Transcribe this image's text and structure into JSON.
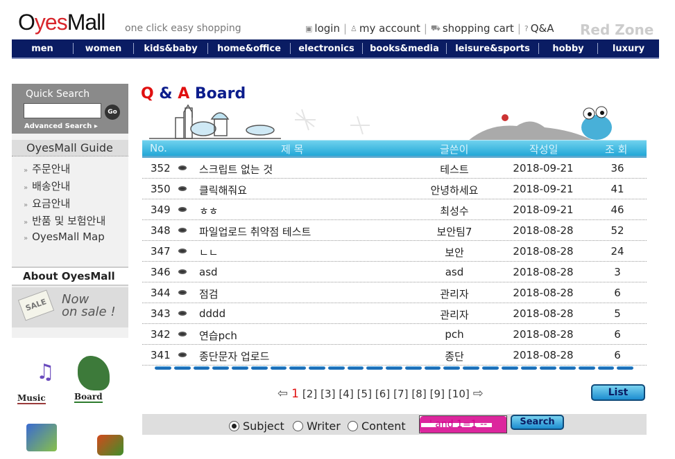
{
  "header": {
    "logo_pre": "O",
    "logo_y": "yes",
    "logo_post": "Mall",
    "tagline": "one click easy shopping",
    "links": {
      "login": "login",
      "account": "my account",
      "cart": "shopping cart",
      "qa": "Q&A"
    },
    "red_zone": "Red Zone"
  },
  "nav": [
    "men",
    "women",
    "kids&baby",
    "home&office",
    "electronics",
    "books&media",
    "leisure&sports",
    "hobby",
    "luxury"
  ],
  "sidebar": {
    "quick_search": "Quick Search",
    "go": "Go",
    "advanced": "Advanced Search ▸",
    "guide_title": "OyesMall Guide",
    "guide_items": [
      "주문안내",
      "배송안내",
      "요금안내",
      "반품 및 보험안내",
      "OyesMall Map"
    ],
    "about_title": "About OyesMall",
    "sale_tag": "SALE",
    "now": "Now",
    "on_sale": "on sale !",
    "music": "Music",
    "board": "Board"
  },
  "board": {
    "title_q": "Q",
    "title_amp": " & ",
    "title_a": "A",
    "title_rest": " Board",
    "columns": {
      "no": "No.",
      "subject": "제 목",
      "writer": "글쓴이",
      "date": "작성일",
      "views": "조 회"
    },
    "rows": [
      {
        "no": "352",
        "title": "스크립트 없는 것",
        "writer": "테스트",
        "date": "2018-09-21",
        "views": "36"
      },
      {
        "no": "350",
        "title": "클릭해줘요",
        "writer": "안녕하세요",
        "date": "2018-09-21",
        "views": "41"
      },
      {
        "no": "349",
        "title": "ㅎㅎ",
        "writer": "최성수",
        "date": "2018-09-21",
        "views": "46"
      },
      {
        "no": "348",
        "title": "파일업로드 취약점 테스트",
        "writer": "보안팀7",
        "date": "2018-08-28",
        "views": "52"
      },
      {
        "no": "347",
        "title": "ㄴㄴ",
        "writer": "보안",
        "date": "2018-08-28",
        "views": "24"
      },
      {
        "no": "346",
        "title": "asd",
        "writer": "asd",
        "date": "2018-08-28",
        "views": "3"
      },
      {
        "no": "344",
        "title": "점검",
        "writer": "관리자",
        "date": "2018-08-28",
        "views": "6"
      },
      {
        "no": "343",
        "title": "dddd",
        "writer": "관리자",
        "date": "2018-08-28",
        "views": "5"
      },
      {
        "no": "342",
        "title": "연습pch",
        "writer": "pch",
        "date": "2018-08-28",
        "views": "6"
      },
      {
        "no": "341",
        "title": "종단문자 업로드",
        "writer": "종단",
        "date": "2018-08-28",
        "views": "6"
      }
    ],
    "pages": [
      "[2]",
      "[3]",
      "[4]",
      "[5]",
      "[6]",
      "[7]",
      "[8]",
      "[9]",
      "[10]"
    ],
    "current_page": "1",
    "list_button": "List"
  },
  "search": {
    "options": {
      "subject": "Subject",
      "writer": "Writer",
      "content": "Content"
    },
    "selected": "Subject",
    "value": "' and 1=1 --",
    "button": "Search"
  }
}
